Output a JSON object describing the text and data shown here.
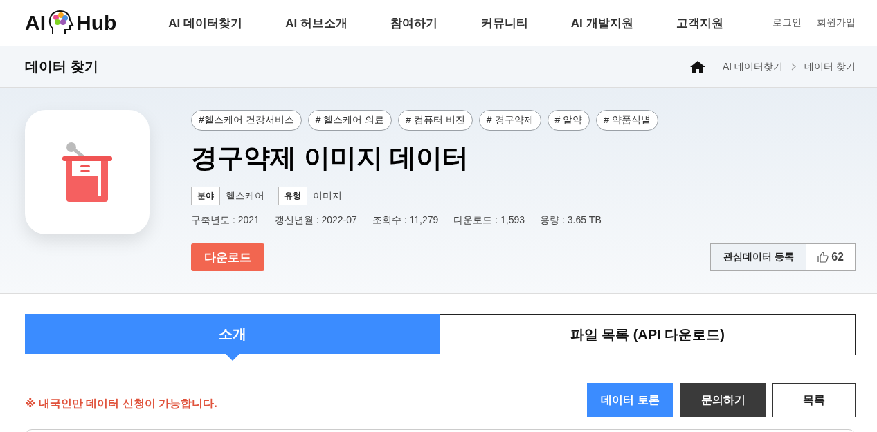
{
  "header": {
    "logo": {
      "left": "AI",
      "right": "Hub"
    },
    "nav": [
      "AI 데이터찾기",
      "AI 허브소개",
      "참여하기",
      "커뮤니티",
      "AI 개발지원",
      "고객지원"
    ],
    "account": [
      "로그인",
      "회원가입"
    ]
  },
  "subheader": {
    "title": "데이터 찾기",
    "breadcrumb": [
      "AI 데이터찾기",
      "데이터 찾기"
    ]
  },
  "dataset": {
    "tags": [
      "#헬스케어 건강서비스",
      "# 헬스케어 의료",
      "# 컴퓨터 비젼",
      "# 경구약제",
      "# 알약",
      "# 약품식별"
    ],
    "title": "경구약제 이미지 데이터",
    "categories": [
      {
        "label": "분야",
        "value": "헬스케어"
      },
      {
        "label": "유형",
        "value": "이미지"
      }
    ],
    "stats": [
      "구축년도 : 2021",
      "갱신년월 : 2022-07",
      "조회수 : 11,279",
      "다운로드 : 1,593",
      "용량 : 3.65 TB"
    ],
    "download": "다운로드",
    "interest": {
      "label": "관심데이터 등록",
      "count": "62"
    }
  },
  "tabs": [
    {
      "label": "소개",
      "selected": true
    },
    {
      "label": "파일 목록 (API 다운로드)",
      "selected": false
    }
  ],
  "notice": "※ 내국인만 데이터 신청이 가능합니다.",
  "actions": [
    {
      "label": "데이터 토론",
      "kind": "primary"
    },
    {
      "label": "문의하기",
      "kind": "dark"
    },
    {
      "label": "목록",
      "kind": "outline"
    }
  ]
}
